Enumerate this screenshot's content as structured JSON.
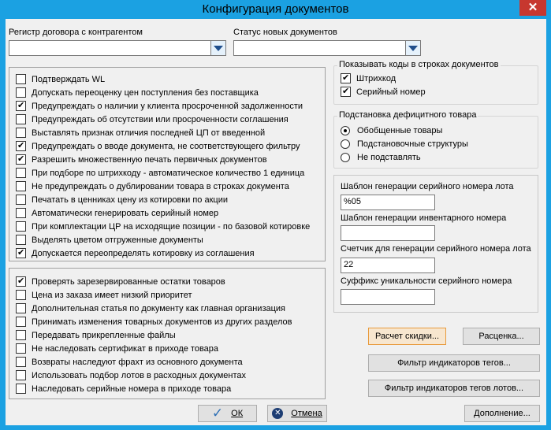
{
  "window": {
    "title": "Конфигурация документов",
    "close_glyph": "✕"
  },
  "contract_register": {
    "label": "Регистр договора с контрагентом",
    "value": ""
  },
  "new_docs_status": {
    "label": "Статус новых документов",
    "value": ""
  },
  "left_options_top": [
    {
      "label": "Подтверждать WL",
      "checked": false
    },
    {
      "label": "Допускать переоценку цен поступления без поставщика",
      "checked": false
    },
    {
      "label": "Предупреждать о наличии у клиента просроченной задолженности",
      "checked": true
    },
    {
      "label": "Предупреждать об отсутствии или просроченности соглашения",
      "checked": false
    },
    {
      "label": "Выставлять признак отличия последней ЦП от введенной",
      "checked": false
    },
    {
      "label": "Предупреждать о вводе документа, не соответствующего фильтру",
      "checked": true
    },
    {
      "label": "Разрешить множественную печать первичных документов",
      "checked": true
    },
    {
      "label": "При подборе по штрихкоду - автоматическое количество 1 единица",
      "checked": false
    },
    {
      "label": "Не предупреждать о дублировании товара в строках документа",
      "checked": false
    },
    {
      "label": "Печатать в ценниках цену из котировки по акции",
      "checked": false
    },
    {
      "label": "Автоматически генерировать серийный номер",
      "checked": false
    },
    {
      "label": "При комплектации ЦР на исходящие позиции - по базовой котировке",
      "checked": false
    },
    {
      "label": "Выделять цветом отгруженные документы",
      "checked": false
    },
    {
      "label": "Допускается переопределять котировку из соглашения",
      "checked": true
    }
  ],
  "left_options_bottom": [
    {
      "label": "Проверять зарезервированные остатки товаров",
      "checked": true
    },
    {
      "label": "Цена из заказа имеет низкий приоритет",
      "checked": false
    },
    {
      "label": "Дополнительная статья по документу как главная организация",
      "checked": false
    },
    {
      "label": "Принимать изменения товарных документов из других разделов",
      "checked": false
    },
    {
      "label": "Передавать прикрепленные файлы",
      "checked": false
    },
    {
      "label": "Не наследовать сертификат в приходе товара",
      "checked": false
    },
    {
      "label": "Возвраты наследуют фрахт из основного документа",
      "checked": false
    },
    {
      "label": "Использовать подбор лотов в расходных документах",
      "checked": false
    },
    {
      "label": "Наследовать серийные номера в приходе товара",
      "checked": false
    }
  ],
  "codes_group": {
    "title": "Показывать коды в строках документов",
    "items": [
      {
        "label": "Штрихкод",
        "checked": true
      },
      {
        "label": "Серийный номер",
        "checked": true
      }
    ]
  },
  "substitution_group": {
    "title": "Подстановка дефицитного товара",
    "items": [
      {
        "label": "Обобщенные товары",
        "selected": true
      },
      {
        "label": "Подстановочные структуры",
        "selected": false
      },
      {
        "label": "Не подставлять",
        "selected": false
      }
    ]
  },
  "templates": {
    "lot_serial_label": "Шаблон генерации серийного номера лота",
    "lot_serial_value": "%05",
    "inventory_label": "Шаблон генерации инвентарного номера",
    "inventory_value": "",
    "counter_label": "Счетчик для генерации серийного номера лота",
    "counter_value": "22",
    "suffix_label": "Суффикс уникальности серийного номера",
    "suffix_value": ""
  },
  "buttons": {
    "discount_calc": "Расчет скидки...",
    "pricing": "Расценка...",
    "tag_filter": "Фильтр индикаторов тегов...",
    "tag_filter_lots": "Фильтр индикаторов тегов лотов...",
    "ok": "ОК",
    "cancel": "Отмена",
    "addition": "Дополнение..."
  }
}
